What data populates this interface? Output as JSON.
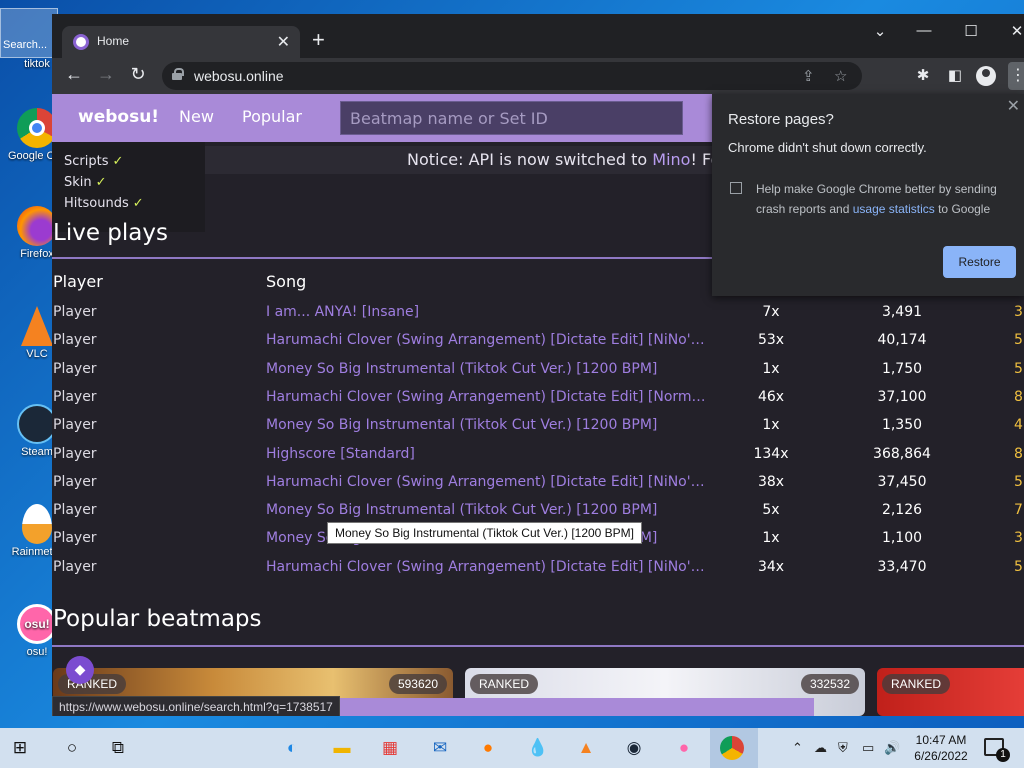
{
  "desktop": {
    "search_label": "Search...",
    "icons": [
      {
        "label": "tiktok"
      },
      {
        "label": "Google Chrome"
      },
      {
        "label": "Firefox"
      },
      {
        "label": "VLC"
      },
      {
        "label": "Steam"
      },
      {
        "label": "Rainmeter"
      },
      {
        "label": "osu!"
      }
    ]
  },
  "chrome": {
    "tab_title": "Home",
    "url": "webosu.online",
    "restore_popup": {
      "title": "Restore pages?",
      "subtitle": "Chrome didn't shut down correctly.",
      "help_text_1": "Help make Google Chrome better by sending crash reports and ",
      "help_link": "usage statistics",
      "help_text_2": " to Google",
      "button": "Restore"
    },
    "status_url": "https://www.webosu.online/search.html?q=1738517"
  },
  "site": {
    "brand": "webosu!",
    "nav": [
      "New",
      "Popular"
    ],
    "search_placeholder": "Beatmap name or Set ID",
    "notice_prefix": "Notice: API is now switched to ",
    "notice_link": "Mino",
    "notice_suffix": "! Fo",
    "dropdown": [
      {
        "label": "Scripts",
        "check": "✓"
      },
      {
        "label": "Skin",
        "check": "✓"
      },
      {
        "label": "Hitsounds",
        "check": "✓"
      }
    ],
    "live_title": "Live plays",
    "col_player": "Player",
    "col_song": "Song",
    "rows": [
      {
        "player": "Player",
        "song": "I am... ANYA! [Insane]",
        "combo": "7x",
        "score": "3,491",
        "extra": "3"
      },
      {
        "player": "Player",
        "song": "Harumachi Clover (Swing Arrangement) [Dictate Edit] [NiNo's Insane]",
        "combo": "53x",
        "score": "40,174",
        "extra": "5"
      },
      {
        "player": "Player",
        "song": "Money So Big Instrumental (Tiktok Cut Ver.) [1200 BPM]",
        "combo": "1x",
        "score": "1,750",
        "extra": "5"
      },
      {
        "player": "Player",
        "song": "Harumachi Clover (Swing Arrangement) [Dictate Edit] [Normal]",
        "combo": "46x",
        "score": "37,100",
        "extra": "8"
      },
      {
        "player": "Player",
        "song": "Money So Big Instrumental (Tiktok Cut Ver.) [1200 BPM]",
        "combo": "1x",
        "score": "1,350",
        "extra": "4"
      },
      {
        "player": "Player",
        "song": "Highscore [Standard]",
        "combo": "134x",
        "score": "368,864",
        "extra": "8"
      },
      {
        "player": "Player",
        "song": "Harumachi Clover (Swing Arrangement) [Dictate Edit] [NiNo's Insane]",
        "combo": "38x",
        "score": "37,450",
        "extra": "5"
      },
      {
        "player": "Player",
        "song": "Money So Big Instrumental (Tiktok Cut Ver.) [1200 BPM]",
        "combo": "5x",
        "score": "2,126",
        "extra": "7"
      },
      {
        "player": "Player",
        "song": "Money So Big Instrumental (Tiktok Cut Ver.) [1200 BPM]",
        "combo": "1x",
        "score": "1,100",
        "extra": "3"
      },
      {
        "player": "Player",
        "song": "Harumachi Clover (Swing Arrangement) [Dictate Edit] [NiNo's Insane]",
        "combo": "34x",
        "score": "33,470",
        "extra": "5"
      }
    ],
    "tooltip": "Money So Big Instrumental (Tiktok Cut Ver.) [1200 BPM]",
    "popular_title": "Popular beatmaps",
    "cards": [
      {
        "status": "RANKED",
        "count": "593620"
      },
      {
        "status": "RANKED",
        "count": "332532"
      },
      {
        "status": "RANKED",
        "count": ""
      }
    ]
  },
  "taskbar": {
    "time": "10:47 AM",
    "date": "6/26/2022",
    "notif_count": "1"
  }
}
